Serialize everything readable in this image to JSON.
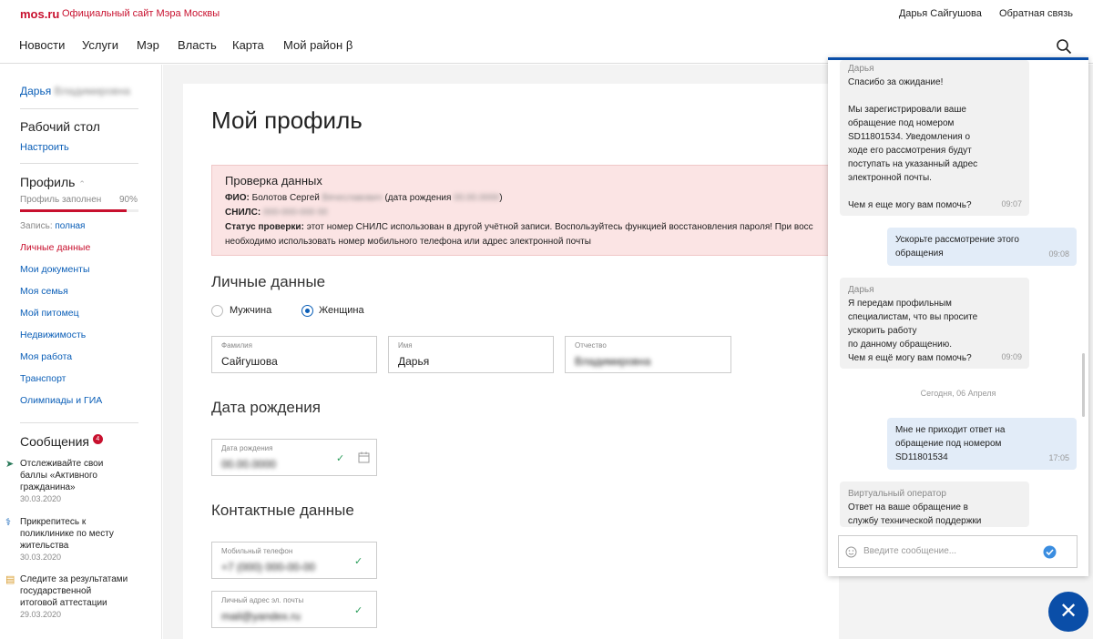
{
  "header": {
    "logo": "mos.ru",
    "site_title": "Официальный сайт Мэра Москвы",
    "user_name": "Дарья Сайгушова",
    "feedback": "Обратная связь"
  },
  "nav": [
    "Новости",
    "Услуги",
    "Мэр",
    "Власть",
    "Карта",
    "Мой район β"
  ],
  "sidebar": {
    "user_first": "Дарья",
    "user_last_blurred": "Владимировна",
    "desk_title": "Рабочий стол",
    "desk_link": "Настроить",
    "profile_title": "Профиль",
    "profile_filled_label": "Профиль заполнен",
    "profile_filled_pct": "90%",
    "profile_filled_value": 0.9,
    "record_label": "Запись:",
    "record_value": "полная",
    "links": [
      "Личные данные",
      "Мои документы",
      "Моя семья",
      "Мой питомец",
      "Недвижимость",
      "Моя работа",
      "Транспорт",
      "Олимпиады и ГИА"
    ],
    "messages_title": "Сообщения",
    "messages_badge": "4",
    "messages": [
      {
        "text": "Отслеживайте свои баллы «Активного гражданина»",
        "date": "30.03.2020"
      },
      {
        "text": "Прикрепитесь к поликлинике по месту жительства",
        "date": "30.03.2020"
      },
      {
        "text": "Следите за результатами государственной итоговой аттестации",
        "date": "29.03.2020"
      }
    ]
  },
  "page": {
    "title": "Мой профиль",
    "alert": {
      "title": "Проверка данных",
      "fio_label": "ФИО:",
      "fio_value": "Болотов Сергей",
      "fio_blur": "Вячеславович",
      "birth_prefix": "(дата рождения",
      "birth_blur": "00.00.0000",
      "birth_suffix": ")",
      "snils_label": "СНИЛС:",
      "snils_blur": "000-000-000 00",
      "status_label": "Статус проверки:",
      "status_text": "этот номер СНИЛС использован в другой учётной записи. Воспользуйтесь функцией восстановления пароля! При восс",
      "status_text2": "необходимо использовать номер мобильного телефона или адрес электронной почты"
    },
    "personal_title": "Личные данные",
    "gender_male": "Мужчина",
    "gender_female": "Женщина",
    "surname_label": "Фамилия",
    "surname_value": "Сайгушова",
    "name_label": "Имя",
    "name_value": "Дарья",
    "patronymic_label": "Отчество",
    "patronymic_blur": "Владимировна",
    "birth_title": "Дата рождения",
    "birth_label": "Дата рождения",
    "birth_blur": "00.00.0000",
    "contacts_title": "Контактные данные",
    "phone_label": "Мобильный телефон",
    "phone_blur": "+7 (000) 000-00-00",
    "email_label": "Личный адрес эл. почты",
    "email_blur": "mail@yandex.ru"
  },
  "chat": {
    "messages": [
      {
        "from": "Дарья",
        "lines": [
          "Спасибо за ожидание!",
          "",
          "Мы зарегистрировали ваше",
          "обращение под номером",
          "SD11801534. Уведомления о",
          "ходе его рассмотрения будут",
          "поступать на указанный адрес",
          "электронной почты.",
          "",
          "Чем я еще могу вам помочь?"
        ],
        "time": "09:07"
      },
      {
        "from": "",
        "lines": [
          "Ускорьте рассмотрение этого",
          "обращения"
        ],
        "time": "09:08"
      },
      {
        "from": "Дарья",
        "lines": [
          "Я передам профильным",
          "специалистам, что вы просите",
          "ускорить работу",
          "по данному обращению.",
          "Чем я ещё могу вам помочь?"
        ],
        "time": "09:09"
      },
      {
        "from": "",
        "lines": [
          "Мне не приходит ответ на",
          "обращение под номером",
          "SD11801534"
        ],
        "time": "17:05"
      },
      {
        "from": "Виртуальный оператор",
        "lines": [
          "Ответ на ваше обращение в",
          "службу технической поддержки"
        ],
        "time": ""
      }
    ],
    "date_separator": "Сегодня, 06 Апреля",
    "input_placeholder": "Введите сообщение..."
  },
  "icons": [
    "search-icon",
    "chevron-up-icon",
    "calendar-icon",
    "check-icon",
    "smile-icon",
    "send-icon",
    "close-icon",
    "arrow-icon",
    "hospital-icon",
    "document-icon"
  ]
}
